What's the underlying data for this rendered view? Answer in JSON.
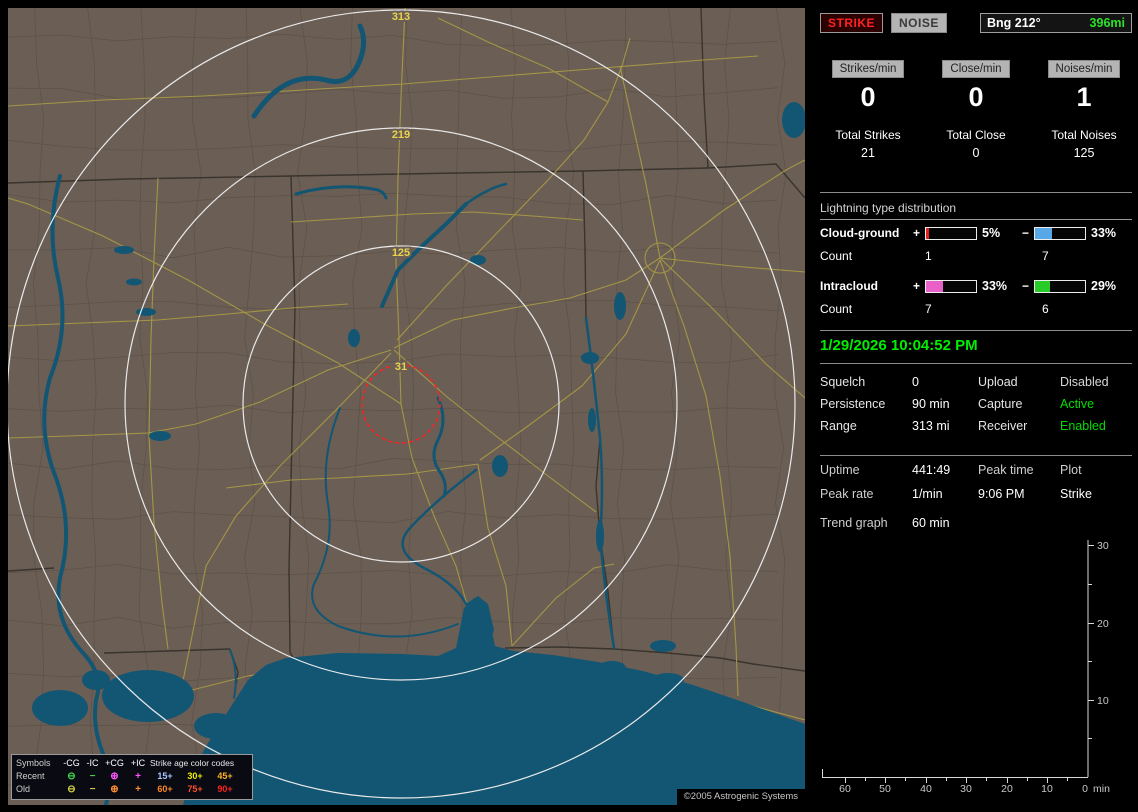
{
  "map": {
    "ring_labels": [
      "313",
      "219",
      "125",
      "31"
    ],
    "colors": {
      "land": "#6b5e55",
      "water": "#125673",
      "roads": "#a79a45",
      "county_lines": "#5a5046",
      "state_borders": "#37322b",
      "range_rings": "#e9e9e9",
      "ring_labels": "#e8d44c",
      "alarm_circle": "#ff2020"
    }
  },
  "legend": {
    "symbols_header": "Symbols",
    "polarity_headers": [
      "-CG",
      "-IC",
      "+CG",
      "+IC"
    ],
    "age_header": "Strike age color codes",
    "rows": [
      {
        "label": "Recent",
        "symbols": [
          "⊖",
          "−",
          "⊕",
          "+"
        ],
        "symbol_colors": [
          "#3fd84a",
          "#3fd84a",
          "#ff55ff",
          "#ff55ff"
        ],
        "ages": [
          "15+",
          "30+",
          "45+"
        ],
        "age_colors": [
          "#a8c8ff",
          "#f0f000",
          "#ffb428"
        ]
      },
      {
        "label": "Old",
        "symbols": [
          "⊖",
          "−",
          "⊕",
          "+"
        ],
        "symbol_colors": [
          "#d0d040",
          "#d0d040",
          "#ff9030",
          "#ff9030"
        ],
        "ages": [
          "60+",
          "75+",
          "90+"
        ],
        "age_colors": [
          "#ff8820",
          "#ff5028",
          "#ff2020"
        ]
      }
    ]
  },
  "copyright": "©2005 Astrogenic Systems",
  "toolbar": {
    "strike": "STRIKE",
    "noise": "NOISE",
    "bearing": "Bng 212°",
    "distance": "396mi",
    "distance_color": "#2ae22a"
  },
  "rates": [
    {
      "badge": "Strikes/min",
      "value": "0",
      "total_label": "Total Strikes",
      "total": "21"
    },
    {
      "badge": "Close/min",
      "value": "0",
      "total_label": "Total Close",
      "total": "0"
    },
    {
      "badge": "Noises/min",
      "value": "1",
      "total_label": "Total Noises",
      "total": "125"
    }
  ],
  "distribution": {
    "title": "Lightning type distribution",
    "count_label": "Count",
    "signs": {
      "plus": "+",
      "minus": "−"
    },
    "rows": [
      {
        "name": "Cloud-ground",
        "plus_pct": "5%",
        "plus_width": "5%",
        "plus_color": "#e02020",
        "plus_count": "1",
        "minus_pct": "33%",
        "minus_width": "33%",
        "minus_color": "#58a8e8",
        "minus_count": "7"
      },
      {
        "name": "Intracloud",
        "plus_pct": "33%",
        "plus_width": "33%",
        "plus_color": "#e860c8",
        "plus_count": "7",
        "minus_pct": "29%",
        "minus_width": "29%",
        "minus_color": "#28cc28",
        "minus_count": "6"
      }
    ]
  },
  "clock": {
    "text": "1/29/2026 10:04:52 PM",
    "color": "#00ee00"
  },
  "settings": [
    {
      "label1": "Squelch",
      "value1": "0",
      "label2": "Upload",
      "value2": "Disabled",
      "value2_color": "#d8d8d8"
    },
    {
      "label1": "Persistence",
      "value1": "90 min",
      "label2": "Capture",
      "value2": "Active",
      "value2_color": "#00dd00"
    },
    {
      "label1": "Range",
      "value1": "313 mi",
      "label2": "Receiver",
      "value2": "Enabled",
      "value2_color": "#00dd00"
    }
  ],
  "session": {
    "uptime_label": "Uptime",
    "uptime": "441:49",
    "peak_rate_label": "Peak rate",
    "peak_rate": "1/min",
    "peak_time_label": "Peak time",
    "peak_time": "9:06 PM",
    "plot_label": "Plot",
    "plot": "Strike",
    "trend_label": "Trend graph",
    "trend_value": "60 min"
  },
  "trend": {
    "y_ticks": [
      "30",
      "20",
      "10"
    ],
    "x_ticks": [
      "60",
      "50",
      "40",
      "30",
      "20",
      "10",
      "0"
    ],
    "x_unit": "min"
  }
}
